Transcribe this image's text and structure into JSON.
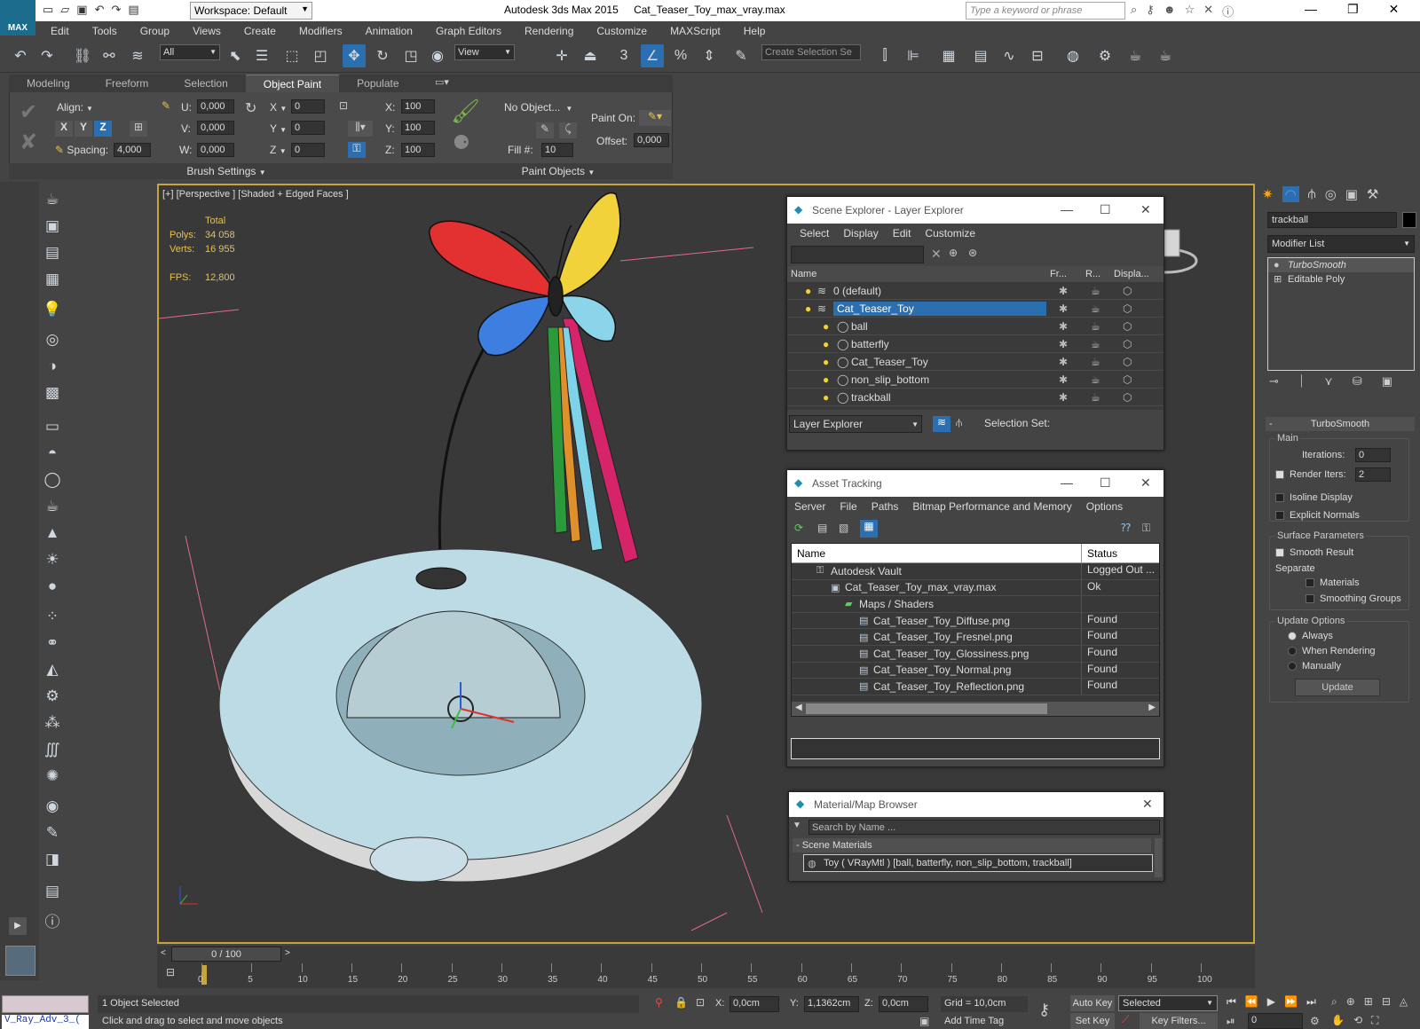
{
  "titlebar": {
    "logo": "MAX",
    "workspace": "Workspace: Default",
    "app_title": "Autodesk 3ds Max  2015",
    "file_title": "Cat_Teaser_Toy_max_vray.max",
    "search_placeholder": "Type a keyword or phrase"
  },
  "menu": [
    "Edit",
    "Tools",
    "Group",
    "Views",
    "Create",
    "Modifiers",
    "Animation",
    "Graph Editors",
    "Rendering",
    "Customize",
    "MAXScript",
    "Help"
  ],
  "maintoolbar": {
    "filter": "All",
    "view": "View",
    "selection_set": "Create Selection Se",
    "snap_label": "3"
  },
  "ribbon": {
    "tabs": [
      "Modeling",
      "Freeform",
      "Selection",
      "Object Paint",
      "Populate"
    ],
    "active_tab": "Object Paint",
    "align_label": "Align:",
    "axes": [
      "X",
      "Y",
      "Z"
    ],
    "spacing_label": "Spacing:",
    "spacing_value": "4,000",
    "u_label": "U:",
    "u_value": "0,000",
    "v_label": "V:",
    "v_value": "0,000",
    "w_label": "W:",
    "w_value": "0,000",
    "x_label": "X",
    "x_value": "0",
    "y_label": "Y",
    "y_value": "0",
    "z_label": "Z",
    "z_value": "0",
    "sx_label": "X:",
    "sx_value": "100",
    "sy_label": "Y:",
    "sy_value": "100",
    "sz_label": "Z:",
    "sz_value": "100",
    "no_object": "No Object...",
    "fill_label": "Fill #:",
    "fill_value": "10",
    "paint_on_label": "Paint On:",
    "offset_label": "Offset:",
    "offset_value": "0,000",
    "brush_settings": "Brush Settings",
    "paint_objects": "Paint Objects"
  },
  "viewport": {
    "label": "[+] [Perspective ] [Shaded + Edged Faces ]",
    "stats_total": "Total",
    "polys_label": "Polys:",
    "polys_value": "34 058",
    "verts_label": "Verts:",
    "verts_value": "16 955",
    "fps_label": "FPS:",
    "fps_value": "12,800"
  },
  "scene_explorer": {
    "title": "Scene Explorer - Layer Explorer",
    "menu": [
      "Select",
      "Display",
      "Edit",
      "Customize"
    ],
    "columns": [
      "Name",
      "Fr...",
      "R...",
      "Displa..."
    ],
    "rows": [
      {
        "name": "0 (default)",
        "indent": 0,
        "selected": false
      },
      {
        "name": "Cat_Teaser_Toy",
        "indent": 0,
        "selected": true
      },
      {
        "name": "ball",
        "indent": 1,
        "selected": false
      },
      {
        "name": "batterfly",
        "indent": 1,
        "selected": false
      },
      {
        "name": "Cat_Teaser_Toy",
        "indent": 1,
        "selected": false
      },
      {
        "name": "non_slip_bottom",
        "indent": 1,
        "selected": false
      },
      {
        "name": "trackball",
        "indent": 1,
        "selected": false
      }
    ],
    "footer_dropdown": "Layer Explorer",
    "selection_set_label": "Selection Set:"
  },
  "asset_tracking": {
    "title": "Asset Tracking",
    "menu": [
      "Server",
      "File",
      "Paths",
      "Bitmap Performance and Memory",
      "Options"
    ],
    "columns": [
      "Name",
      "Status"
    ],
    "rows": [
      {
        "name": "Autodesk Vault",
        "status": "Logged Out ...",
        "indent": 0
      },
      {
        "name": "Cat_Teaser_Toy_max_vray.max",
        "status": "Ok",
        "indent": 1
      },
      {
        "name": "Maps / Shaders",
        "status": "",
        "indent": 2
      },
      {
        "name": "Cat_Teaser_Toy_Diffuse.png",
        "status": "Found",
        "indent": 3
      },
      {
        "name": "Cat_Teaser_Toy_Fresnel.png",
        "status": "Found",
        "indent": 3
      },
      {
        "name": "Cat_Teaser_Toy_Glossiness.png",
        "status": "Found",
        "indent": 3
      },
      {
        "name": "Cat_Teaser_Toy_Normal.png",
        "status": "Found",
        "indent": 3
      },
      {
        "name": "Cat_Teaser_Toy_Reflection.png",
        "status": "Found",
        "indent": 3
      }
    ]
  },
  "material_browser": {
    "title": "Material/Map Browser",
    "search_placeholder": "Search by Name ...",
    "section": "- Scene Materials",
    "material": "Toy  ( VRayMtl ) [ball, batterfly, non_slip_bottom, trackball]"
  },
  "command_panel": {
    "object_name": "trackball",
    "modifier_list": "Modifier List",
    "stack": [
      "TurboSmooth",
      "Editable Poly"
    ],
    "rollout_title": "TurboSmooth",
    "main_group": "Main",
    "iterations_label": "Iterations:",
    "iterations_value": "0",
    "render_iters_label": "Render Iters:",
    "render_iters_value": "2",
    "isoline": "Isoline Display",
    "explicit_normals": "Explicit Normals",
    "surface_group": "Surface Parameters",
    "smooth_result": "Smooth Result",
    "separate_label": "Separate",
    "materials": "Materials",
    "smoothing_groups": "Smoothing Groups",
    "update_group": "Update Options",
    "always": "Always",
    "when_rendering": "When Rendering",
    "manually": "Manually",
    "update_button": "Update"
  },
  "timeline": {
    "frame": "0 / 100",
    "ticks": [
      "0",
      "5",
      "10",
      "15",
      "20",
      "25",
      "30",
      "35",
      "40",
      "45",
      "50",
      "55",
      "60",
      "65",
      "70",
      "75",
      "80",
      "85",
      "90",
      "95",
      "100"
    ]
  },
  "status": {
    "script_listener": "V_Ray_Adv_3_(",
    "selected_count": "1 Object Selected",
    "prompt": "Click and drag to select and move objects",
    "x_label": "X:",
    "x_value": "0,0cm",
    "y_label": "Y:",
    "y_value": "1,1362cm",
    "z_label": "Z:",
    "z_value": "0,0cm",
    "grid": "Grid = 10,0cm",
    "add_time_tag": "Add Time Tag",
    "auto_key": "Auto Key",
    "set_key": "Set Key",
    "selected_dropdown": "Selected",
    "key_filters": "Key Filters...",
    "frame_value": "0"
  }
}
